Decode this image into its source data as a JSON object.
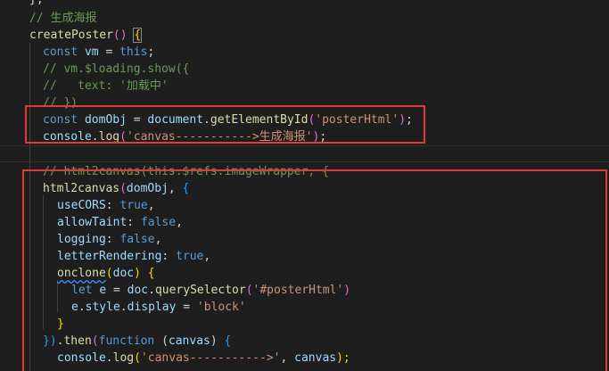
{
  "editor": {
    "lines": [
      [
        "},"
      ],
      [
        "// 生成海报"
      ],
      [
        "createPoster",
        "()",
        " ",
        "{"
      ],
      [
        "const",
        " ",
        "vm",
        " = ",
        "this",
        ";"
      ],
      [
        "// vm.$loading.show({"
      ],
      [
        "//   text: '加载中'"
      ],
      [
        "// })"
      ],
      [
        "const",
        " ",
        "domObj",
        " = ",
        "document",
        ".",
        "getElementById",
        "(",
        "'posterHtml'",
        ")",
        ";"
      ],
      [
        "console",
        ".",
        "log",
        "(",
        "'canvas----------->生成海报'",
        ")",
        ";"
      ],
      [
        ""
      ],
      [
        "// html2canvas(this.$refs.imageWrapper, {"
      ],
      [
        "html2canvas",
        "(",
        "domObj",
        ", ",
        "{"
      ],
      [
        "useCORS",
        ": ",
        "true",
        ","
      ],
      [
        "allowTaint",
        ": ",
        "false",
        ","
      ],
      [
        "logging",
        ": ",
        "false",
        ","
      ],
      [
        "letterRendering",
        ": ",
        "true",
        ","
      ],
      [
        "onclone",
        "(",
        "doc",
        ") ",
        "{"
      ],
      [
        "let",
        " ",
        "e",
        " = ",
        "doc",
        ".",
        "querySelector",
        "(",
        "'#posterHtml'",
        ")"
      ],
      [
        "e",
        ".",
        "style",
        ".",
        "display",
        " = ",
        "'block'"
      ],
      [
        "}"
      ],
      [
        "})",
        ".",
        "then",
        "(",
        "function",
        " (",
        "canvas",
        ") ",
        "{"
      ],
      [
        "console",
        ".",
        "log",
        "(",
        "'canvas----------->'",
        ", ",
        "canvas",
        ");"
      ]
    ]
  }
}
